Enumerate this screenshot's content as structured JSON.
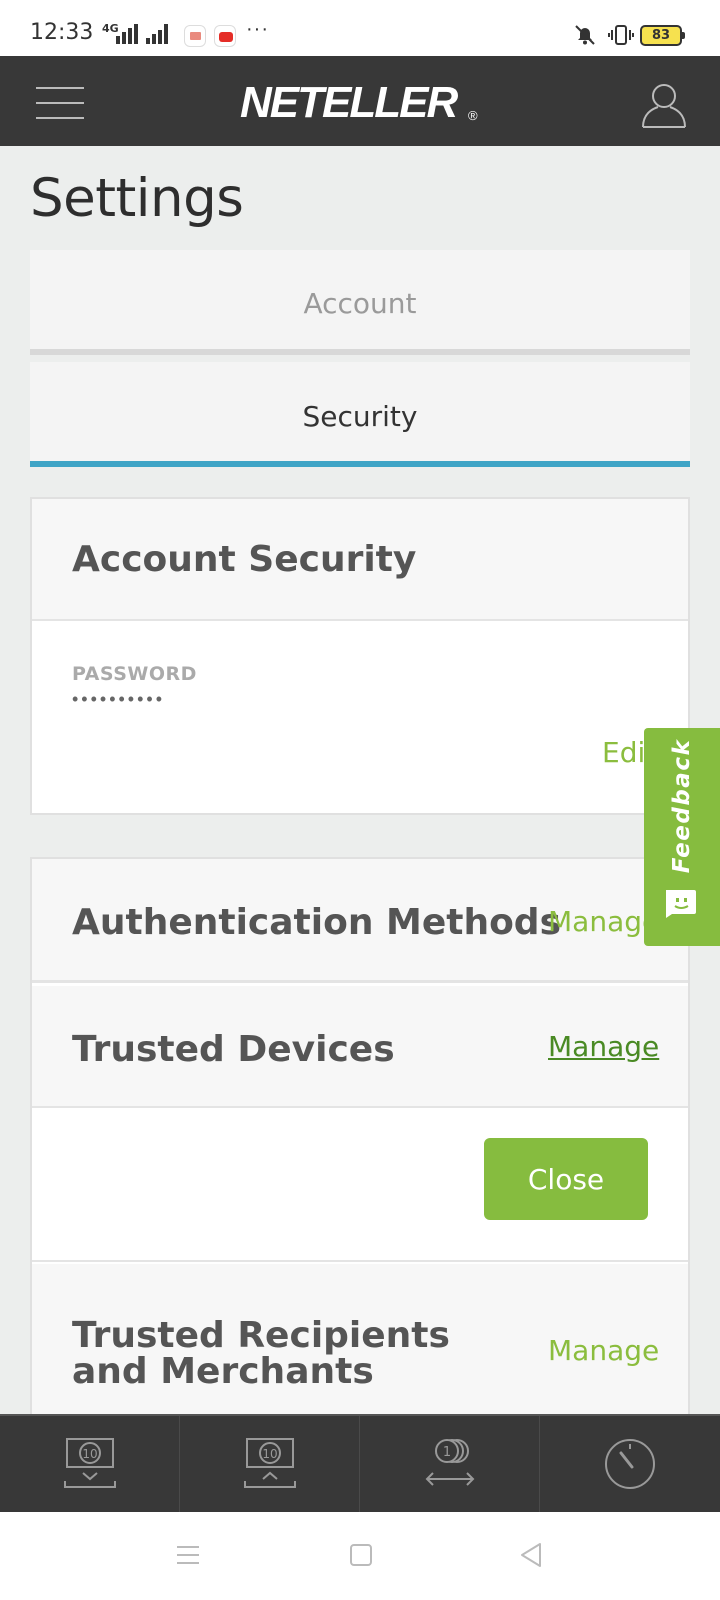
{
  "status_bar": {
    "time": "12:33",
    "network": "4G",
    "more": "···",
    "battery": "83"
  },
  "header": {
    "logo": "NETELLER",
    "logo_mark": "®"
  },
  "page": {
    "title": "Settings"
  },
  "tabs": [
    {
      "label": "Account",
      "active": false
    },
    {
      "label": "Security",
      "active": true
    }
  ],
  "account_security": {
    "title": "Account Security",
    "password_label": "PASSWORD",
    "password_value": "••••••••••",
    "edit_label": "Edit"
  },
  "security_rows": {
    "auth_methods": {
      "title": "Authentication Methods",
      "action": "Manage"
    },
    "trusted_devices": {
      "title": "Trusted Devices",
      "action": "Manage"
    },
    "close_label": "Close",
    "trusted_recipients": {
      "title": "Trusted Recipients and Merchants",
      "action": "Manage"
    }
  },
  "feedback": {
    "label": "Feedback"
  },
  "bottom_nav": {
    "items": [
      {
        "icon": "deposit-icon",
        "badge": "10"
      },
      {
        "icon": "withdraw-icon",
        "badge": "10"
      },
      {
        "icon": "transfer-icon",
        "badge": "1"
      },
      {
        "icon": "gauge-icon"
      }
    ]
  },
  "colors": {
    "header_bg": "#383838",
    "accent_blue": "#3fa4c6",
    "accent_green": "#86bc3f",
    "link_green": "#8bbd3e"
  }
}
